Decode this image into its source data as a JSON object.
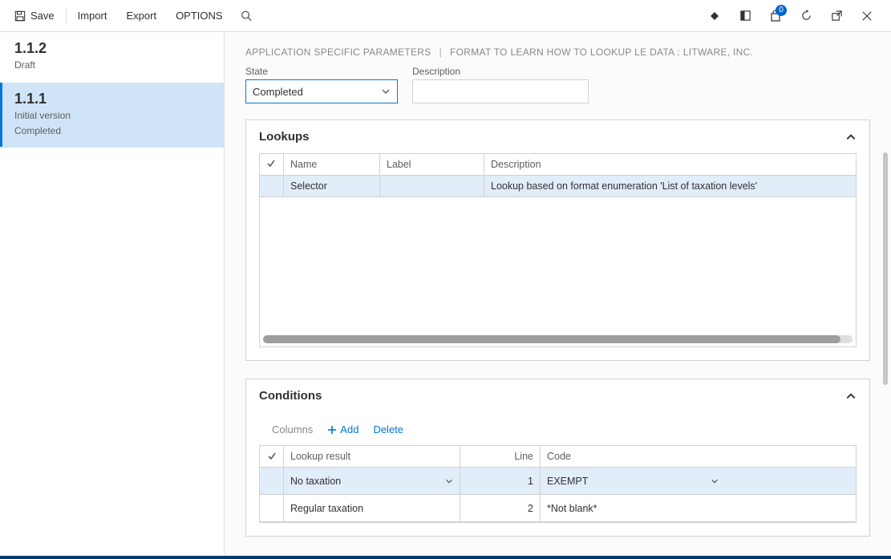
{
  "toolbar": {
    "save": "Save",
    "import": "Import",
    "export": "Export",
    "options": "OPTIONS"
  },
  "notification_count": "0",
  "versions": [
    {
      "number": "1.1.2",
      "lines": [
        "Draft"
      ],
      "selected": false
    },
    {
      "number": "1.1.1",
      "lines": [
        "Initial version",
        "Completed"
      ],
      "selected": true
    }
  ],
  "breadcrumb": {
    "a": "APPLICATION SPECIFIC PARAMETERS",
    "b": "FORMAT TO LEARN HOW TO LOOKUP LE DATA : LITWARE, INC."
  },
  "fields": {
    "state_label": "State",
    "state_value": "Completed",
    "description_label": "Description",
    "description_value": ""
  },
  "lookups": {
    "title": "Lookups",
    "headers": {
      "name": "Name",
      "label": "Label",
      "description": "Description"
    },
    "rows": [
      {
        "name": "Selector",
        "label": "",
        "description": "Lookup based on format enumeration 'List of taxation levels'"
      }
    ]
  },
  "conditions": {
    "title": "Conditions",
    "toolbar": {
      "columns": "Columns",
      "add": "Add",
      "delete": "Delete"
    },
    "headers": {
      "result": "Lookup result",
      "line": "Line",
      "code": "Code"
    },
    "rows": [
      {
        "result": "No taxation",
        "line": "1",
        "code": "EXEMPT",
        "selected": true
      },
      {
        "result": "Regular taxation",
        "line": "2",
        "code": "*Not blank*",
        "selected": false
      }
    ]
  }
}
